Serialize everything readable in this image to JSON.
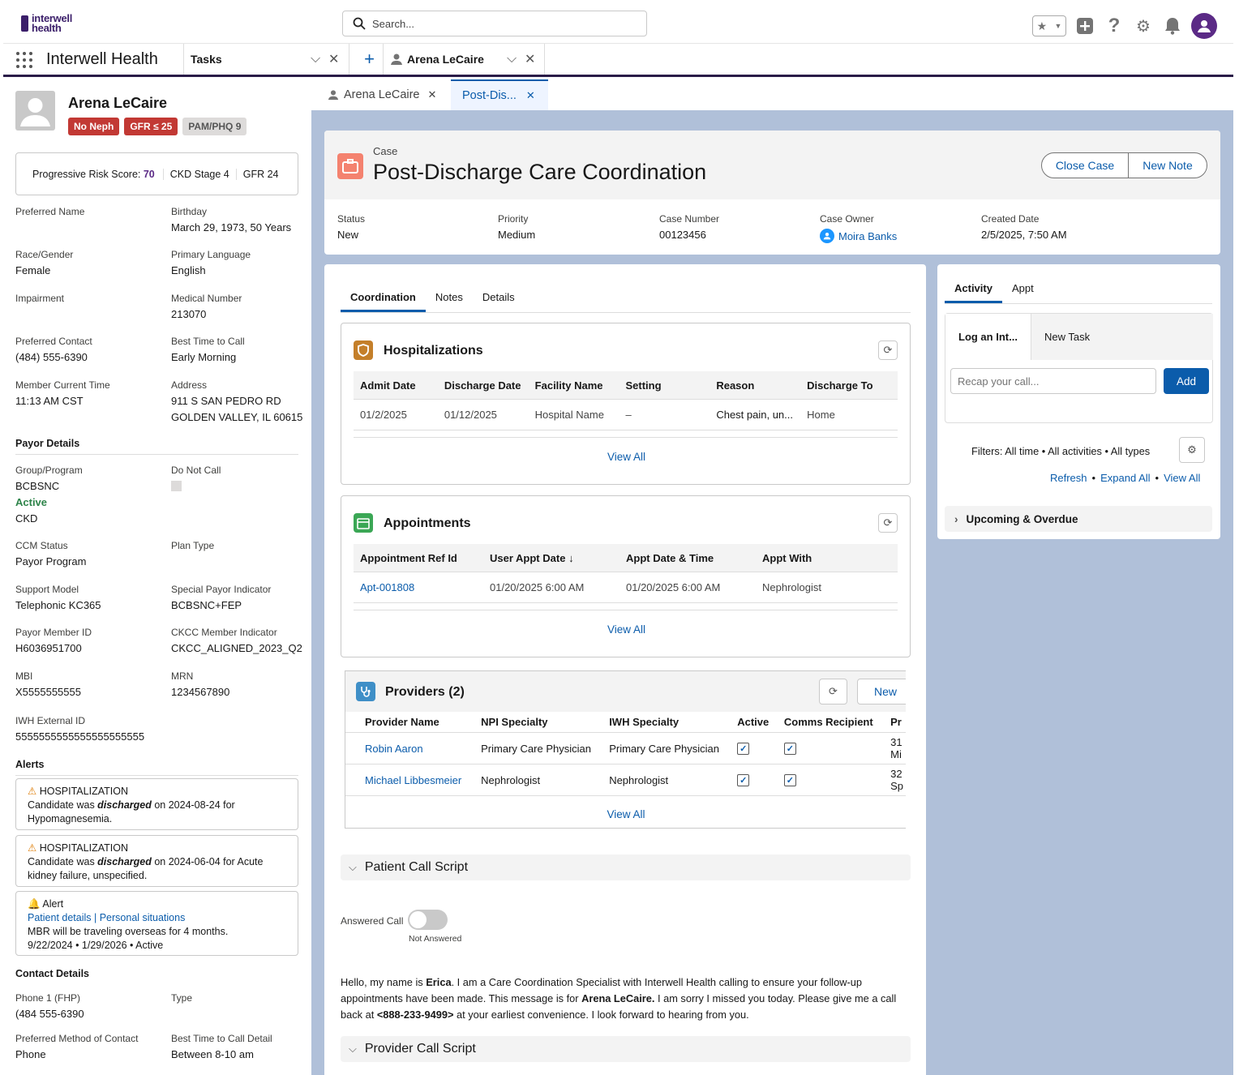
{
  "header": {
    "logo_line1": "interwell",
    "logo_line2": "health",
    "search_placeholder": "Search..."
  },
  "nav": {
    "app_name": "Interwell Health",
    "tab_tasks": "Tasks",
    "tab_patient": "Arena LeCaire"
  },
  "patient": {
    "name": "Arena LeCaire",
    "badges": [
      {
        "label": "No Neph",
        "color": "#c23934"
      },
      {
        "label": "GFR ≤ 25",
        "color": "#c23934"
      },
      {
        "label": "PAM/PHQ 9",
        "color": "#dddbda"
      }
    ],
    "risk_label": "Progressive Risk Score:",
    "risk_value": "70",
    "ckd": "CKD Stage 4",
    "gfr": "GFR 24",
    "fields": [
      {
        "l": "Preferred Name",
        "v": ""
      },
      {
        "l": "Birthday",
        "v": "March 29, 1973, 50 Years"
      },
      {
        "l": "Race/Gender",
        "v": "Female"
      },
      {
        "l": "Primary Language",
        "v": "English"
      },
      {
        "l": "Impairment",
        "v": ""
      },
      {
        "l": "Medical Number",
        "v": "213070"
      },
      {
        "l": "Preferred Contact",
        "v": "(484) 555-6390"
      },
      {
        "l": "Best Time to Call",
        "v": "Early Morning"
      },
      {
        "l": "Member Current Time",
        "v": "11:13 AM CST"
      },
      {
        "l": "Address",
        "v": "911 S SAN PEDRO RD"
      },
      {
        "address2": "GOLDEN VALLEY, IL 60615"
      }
    ],
    "payor_title": "Payor Details",
    "payor": {
      "group_l": "Group/Program",
      "group_v": "BCBSNC",
      "active": "Active",
      "ckd": "CKD",
      "dnc_l": "Do Not Call",
      "ccm_l": "CCM Status",
      "ccm_v": "Payor Program",
      "plan_l": "Plan Type",
      "support_l": "Support Model",
      "support_v": "Telephonic KC365",
      "spi_l": "Special Payor Indicator",
      "spi_v": "BCBSNC+FEP",
      "pmid_l": "Payor Member ID",
      "pmid_v": "H6036951700",
      "ckcc_l": "CKCC Member Indicator",
      "ckcc_v": "CKCC_ALIGNED_2023_Q2",
      "mbi_l": "MBI",
      "mbi_v": "X5555555555",
      "mrn_l": "MRN",
      "mrn_v": "1234567890",
      "iwh_l": "IWH External ID",
      "iwh_v": "5555555555555555555555"
    },
    "alerts_title": "Alerts",
    "alerts": [
      {
        "type": "HOSPITALIZATION",
        "pre": "Candidate was ",
        "em": "discharged",
        "post": " on 2024-08-24 for",
        "line2": "Hypomagnesemia."
      },
      {
        "type": "HOSPITALIZATION",
        "pre": "Candidate was ",
        "em": "discharged",
        "post": " on 2024-06-04 for Acute",
        "line2": "kidney failure, unspecified."
      }
    ],
    "alert3": {
      "type": "Alert",
      "links": "Patient details | Personal situations",
      "text": "MBR will be traveling overseas for 4 months.",
      "dates": "9/22/2024 • 1/29/2026 • Active"
    },
    "contact_title": "Contact Details",
    "contact": {
      "p1_l": "Phone 1 (FHP)",
      "p1_v": "(484 555-6390",
      "type_l": "Type",
      "pmc_l": "Preferred Method of Contact",
      "pmc_v": "Phone",
      "btc_l": "Best Time to Call Detail",
      "btc_v": "Between 8-10 am"
    }
  },
  "subtabs": {
    "t1": "Arena LeCaire",
    "t2": "Post-Dis..."
  },
  "case": {
    "kicker": "Case",
    "title": "Post-Discharge Care Coordination",
    "close": "Close Case",
    "new_note": "New Note",
    "fields": [
      {
        "l": "Status",
        "v": "New"
      },
      {
        "l": "Priority",
        "v": "Medium"
      },
      {
        "l": "Case Number",
        "v": "00123456"
      },
      {
        "l": "Case Owner",
        "v": "Moira Banks"
      },
      {
        "l": "Created Date",
        "v": "2/5/2025, 7:50 AM"
      }
    ]
  },
  "coord": {
    "tabs": [
      "Coordination",
      "Notes",
      "Details"
    ],
    "hosp": {
      "title": "Hospitalizations",
      "cols": [
        "Admit Date",
        "Discharge Date",
        "Facility Name",
        "Setting",
        "Reason",
        "Discharge To"
      ],
      "row": [
        "01/2/2025",
        "01/12/2025",
        "Hospital Name",
        "–",
        "Chest pain, un...",
        "Home"
      ],
      "view_all": "View All"
    },
    "appt": {
      "title": "Appointments",
      "cols": [
        "Appointment Ref Id",
        "User Appt Date",
        "Appt Date & Time",
        "Appt With"
      ],
      "row": [
        "Apt-001808",
        "01/20/2025 6:00 AM",
        "01/20/2025 6:00 AM",
        "Nephrologist"
      ],
      "view_all": "View All"
    },
    "prov": {
      "title": "Providers (2)",
      "new": "New",
      "cols": [
        "Provider Name",
        "NPI Specialty",
        "IWH Specialty",
        "Active",
        "Comms Recipient",
        "Pr"
      ],
      "rows": [
        [
          "Robin Aaron",
          "Primary Care Physician",
          "Primary Care Physician",
          "31",
          "Mi"
        ],
        [
          "Michael Libbesmeier",
          "Nephrologist",
          "Nephrologist",
          "32",
          "Sp"
        ]
      ],
      "view_all": "View All"
    },
    "script1": "Patient Call Script",
    "answered_l": "Answered Call",
    "answered_state": "Not Answered",
    "script_text": {
      "a": "Hello, my name is ",
      "b": "Erica",
      "c": ". I am a Care Coordination Specialist with Interwell Health calling to ensure your follow-up",
      "d": "appointments have been made. This message is for ",
      "e": "Arena LeCaire.",
      "f": " I am sorry I missed you today. Please give me a call",
      "g": "back at ",
      "h": "<888-233-9499>",
      "i": " at your earliest convenience. I look forward to hearing from you."
    },
    "script2": "Provider Call Script"
  },
  "activity": {
    "tabs": [
      "Activity",
      "Appt"
    ],
    "log": "Log an Int...",
    "new_task": "New Task",
    "placeholder": "Recap your call...",
    "add": "Add",
    "filters": "Filters: All time • All activities • All types",
    "refresh": "Refresh",
    "expand": "Expand All",
    "view_all": "View All",
    "upcoming": "Upcoming & Overdue"
  }
}
